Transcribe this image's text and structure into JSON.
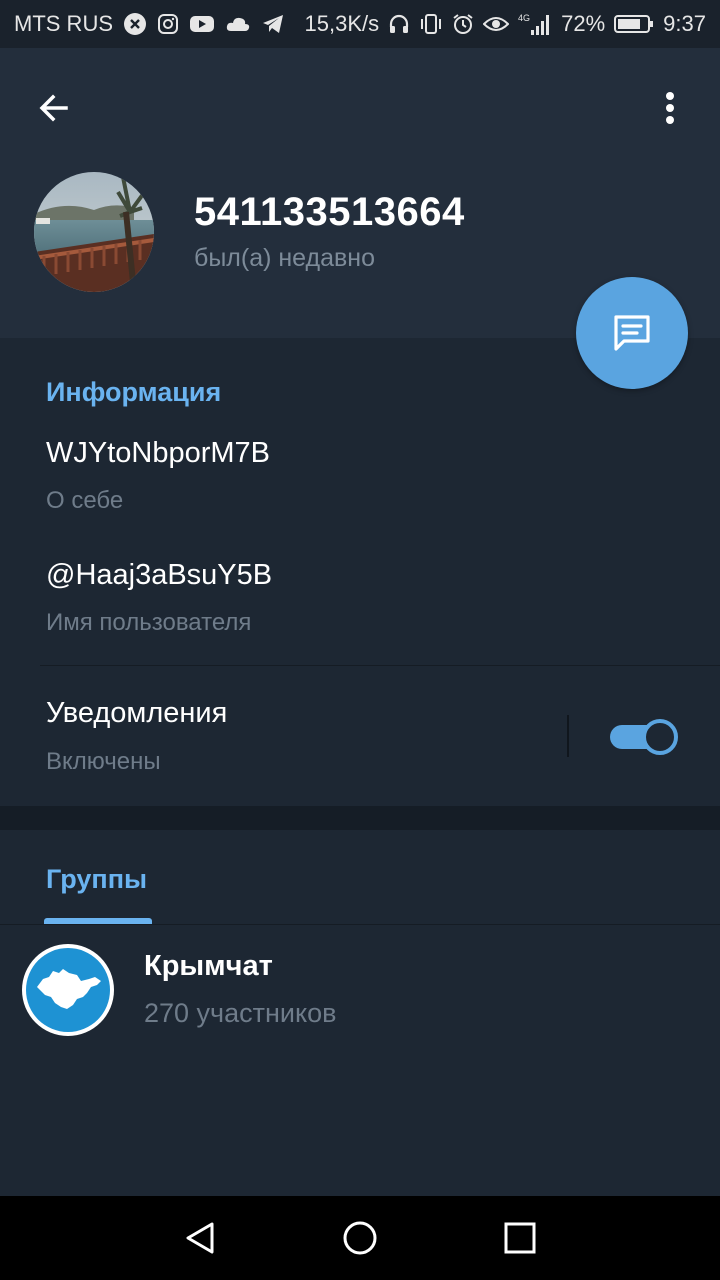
{
  "status_bar": {
    "carrier": "MTS RUS",
    "speed": "15,3K/s",
    "network": "4G",
    "battery": "72%",
    "time": "9:37"
  },
  "header": {
    "back_icon": "arrow-left-icon",
    "menu_icon": "more-vertical-icon",
    "name": "541133513664",
    "status": "был(а) недавно",
    "fab_icon": "message-icon"
  },
  "info": {
    "title": "Информация",
    "bio_value": "WJYtoNbporM7B",
    "bio_label": "О себе",
    "username_value": "@Haaj3aBsuY5B",
    "username_label": "Имя пользователя",
    "notifications_label": "Уведомления",
    "notifications_status": "Включены",
    "notifications_enabled": true
  },
  "groups": {
    "tab_label": "Группы",
    "items": [
      {
        "name": "Крымчат",
        "members": "270 участников"
      }
    ]
  },
  "colors": {
    "accent": "#5aa4e0",
    "section_title": "#6ab3f0",
    "background": "#1d2733",
    "header_background": "#232e3c"
  }
}
